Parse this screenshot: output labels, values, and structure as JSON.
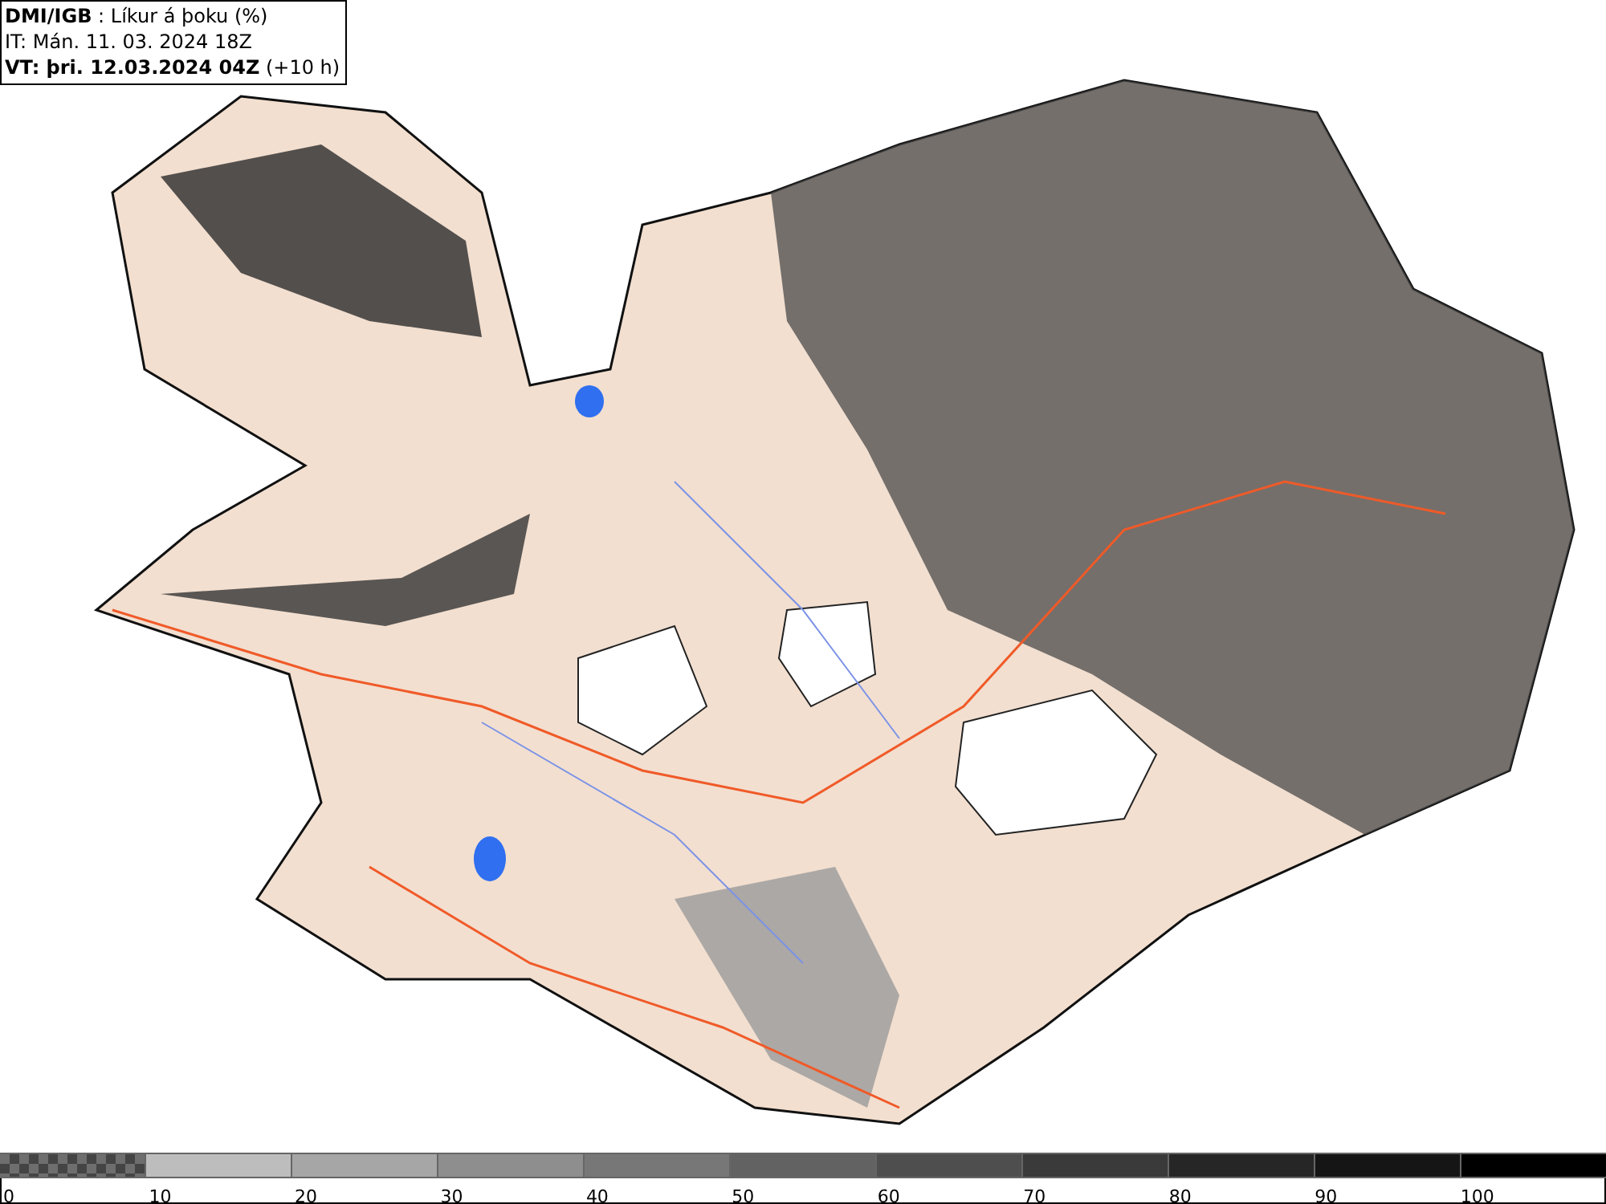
{
  "header": {
    "title": "**DMI/IGB** : Líkur á þoku (%)",
    "issue_time": "IT: Mán. 11. 03. 2024 18Z",
    "valid_time": "**VT: þri. 12.03.2024 04Z** (+10 h)"
  },
  "legend": {
    "segments": [
      {
        "kind": "checker",
        "color": "#6e6e6e",
        "label": "0"
      },
      {
        "kind": "solid",
        "color": "#bdbdbd",
        "label": "10"
      },
      {
        "kind": "solid",
        "color": "#a6a6a6",
        "label": "20"
      },
      {
        "kind": "solid",
        "color": "#8e8e8e",
        "label": "30"
      },
      {
        "kind": "solid",
        "color": "#777777",
        "label": "40"
      },
      {
        "kind": "solid",
        "color": "#626262",
        "label": "50"
      },
      {
        "kind": "solid",
        "color": "#4e4e4e",
        "label": "60"
      },
      {
        "kind": "solid",
        "color": "#3a3a3a",
        "label": "70"
      },
      {
        "kind": "solid",
        "color": "#262626",
        "label": "80"
      },
      {
        "kind": "solid",
        "color": "#151515",
        "label": "90"
      },
      {
        "kind": "solid",
        "color": "#000000",
        "label": "100"
      }
    ]
  }
}
